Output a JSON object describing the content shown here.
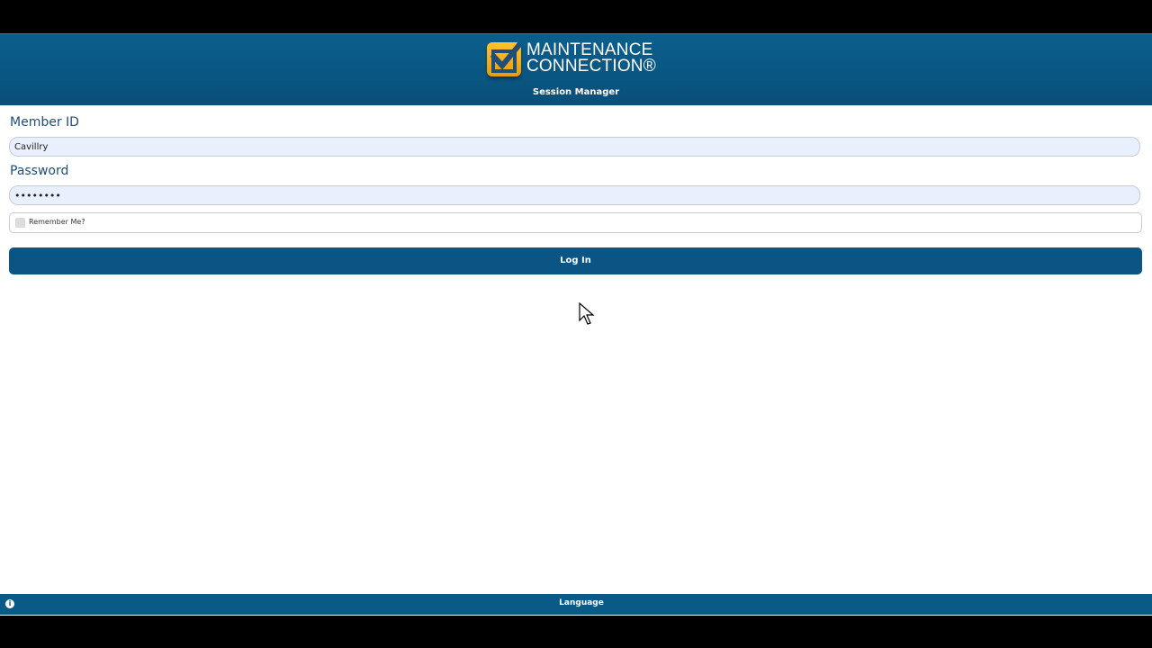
{
  "brand": {
    "line1": "MAINTENANCE",
    "line2": "CONNECTION®",
    "subtitle": "Session Manager"
  },
  "form": {
    "member_id_label": "Member ID",
    "member_id_value": "Cavillry",
    "password_label": "Password",
    "password_value": "••••••••",
    "remember_label": "Remember Me?",
    "login_label": "Log In"
  },
  "footer": {
    "info_icon": "info-icon",
    "language_label": "Language"
  },
  "colors": {
    "brand_blue": "#0b5585",
    "logo_gold": "#f3b21b"
  }
}
